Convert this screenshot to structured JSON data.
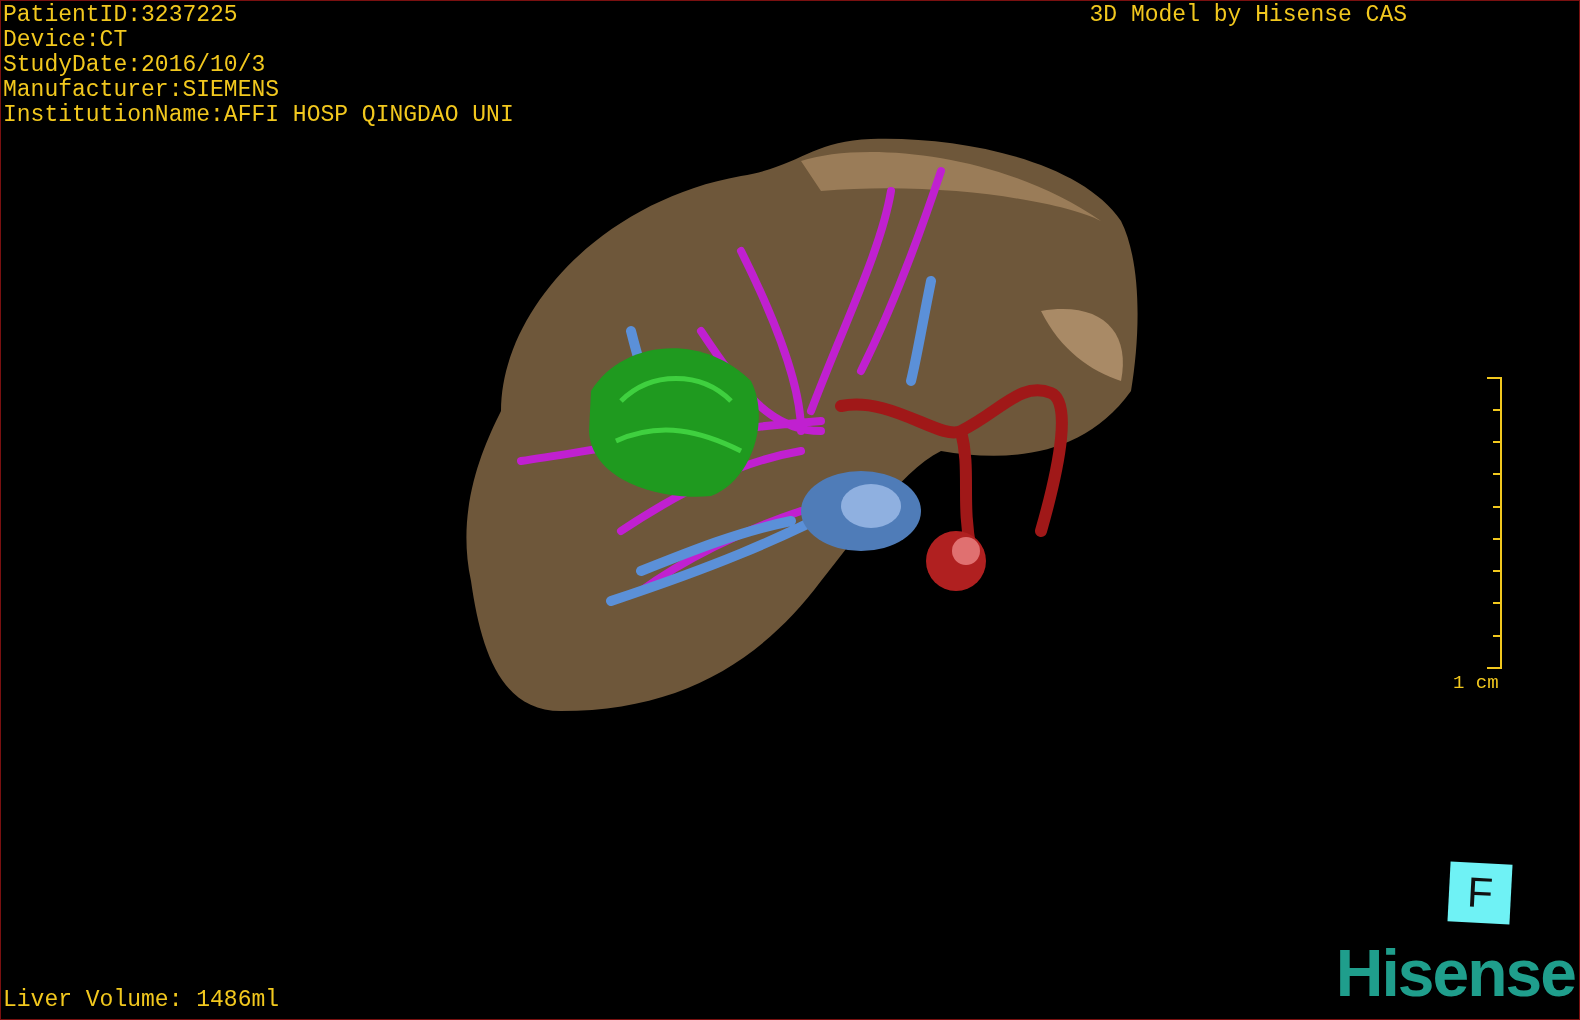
{
  "patient_info": [
    "PatientID:3237225",
    "Device:CT",
    "StudyDate:2016/10/3",
    "Manufacturer:SIEMENS",
    "InstitutionName:AFFI HOSP QINGDAO UNI"
  ],
  "credit": "3D Model by Hisense CAS",
  "scale_bar": {
    "label": "1 cm"
  },
  "orientation_marker": {
    "label": "F"
  },
  "liver_volume": "Liver Volume: 1486ml",
  "logo": "Hisense"
}
